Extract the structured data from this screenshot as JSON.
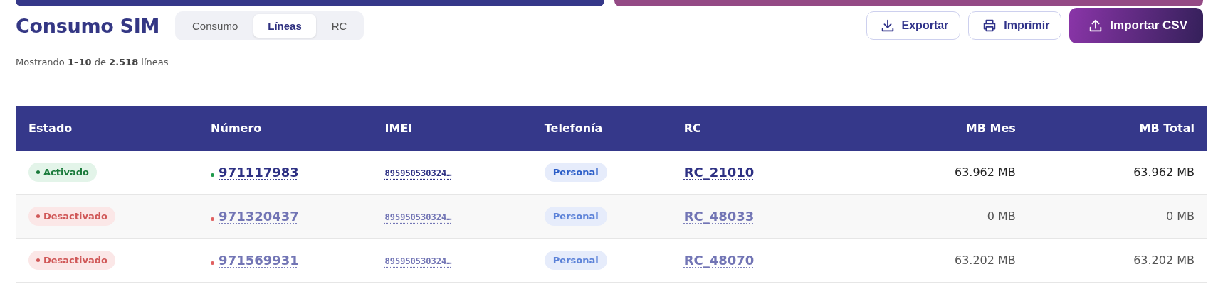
{
  "title": "Consumo SIM",
  "tabs": [
    {
      "label": "Consumo",
      "selected": false
    },
    {
      "label": "Líneas",
      "selected": true
    },
    {
      "label": "RC",
      "selected": false
    }
  ],
  "actions": [
    {
      "label": "Exportar",
      "kind": "download",
      "primary": false
    },
    {
      "label": "Imprimir",
      "kind": "print",
      "primary": false
    },
    {
      "label": "Importar CSV",
      "kind": "upload",
      "primary": true
    }
  ],
  "summary": "Mostrando **1–10** de **2.518** líneas",
  "table": {
    "columns": [
      "Estado",
      "Número",
      "IMEI",
      "Telefonía",
      "RC",
      "MB Mes",
      "MB Total"
    ],
    "rows": [
      {
        "status": "Activado",
        "active": true,
        "number": "971117983",
        "imei": "895950530324…",
        "telefonia": "Personal",
        "rc": "RC_21010",
        "mb_mes": "63.962 MB",
        "mb_total": "63.962 MB"
      },
      {
        "status": "Desactivado",
        "active": false,
        "number": "971320437",
        "imei": "895950530324…",
        "telefonia": "Personal",
        "rc": "RC_48033",
        "mb_mes": "0 MB",
        "mb_total": "0 MB"
      },
      {
        "status": "Desactivado",
        "active": false,
        "number": "971569931",
        "imei": "895950530324…",
        "telefonia": "Personal",
        "rc": "RC_48070",
        "mb_mes": "63.202 MB",
        "mb_total": "63.202 MB"
      }
    ]
  }
}
